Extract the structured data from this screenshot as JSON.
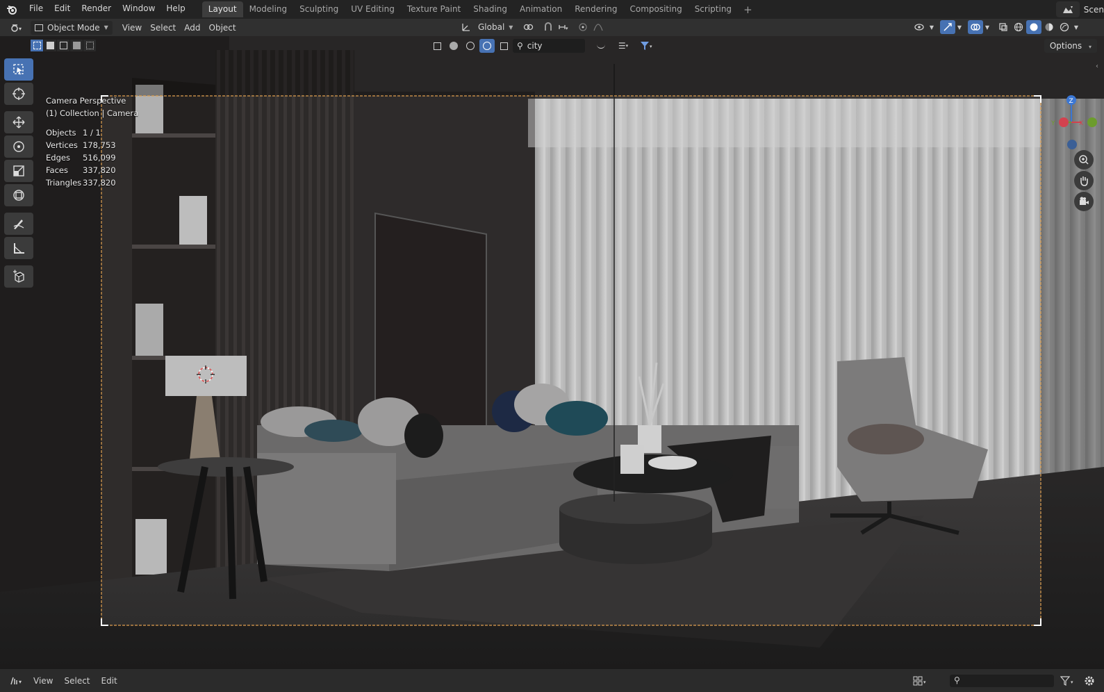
{
  "app": {
    "logo_icon": "blender-logo-icon"
  },
  "menu": [
    "File",
    "Edit",
    "Render",
    "Window",
    "Help"
  ],
  "workspaces": [
    "Layout",
    "Modeling",
    "Sculpting",
    "UV Editing",
    "Texture Paint",
    "Shading",
    "Animation",
    "Rendering",
    "Compositing",
    "Scripting"
  ],
  "active_workspace": "Layout",
  "scene_label": "Scen",
  "header": {
    "mode": "Object Mode",
    "menus": [
      "View",
      "Select",
      "Add",
      "Object"
    ],
    "transform_orientation": "Global"
  },
  "viewport": {
    "search_value": "city",
    "options_label": "Options",
    "camera_title": "Camera Perspective",
    "collection_line": "(1) Collection | Camera",
    "stats": [
      {
        "key": "Objects",
        "value": "1 / 1"
      },
      {
        "key": "Vertices",
        "value": "178,753"
      },
      {
        "key": "Edges",
        "value": "516,099"
      },
      {
        "key": "Faces",
        "value": "337,820"
      },
      {
        "key": "Triangles",
        "value": "337,820"
      }
    ],
    "gizmo_axes": [
      "Z",
      "Y",
      "X"
    ]
  },
  "bottom": {
    "menus": [
      "View",
      "Select",
      "Edit"
    ]
  },
  "colors": {
    "accent": "#4772b3",
    "camera_frame": "#e0a050",
    "axis_x": "#d2424f",
    "axis_y": "#6c9c2c",
    "axis_z": "#3b77d4"
  }
}
